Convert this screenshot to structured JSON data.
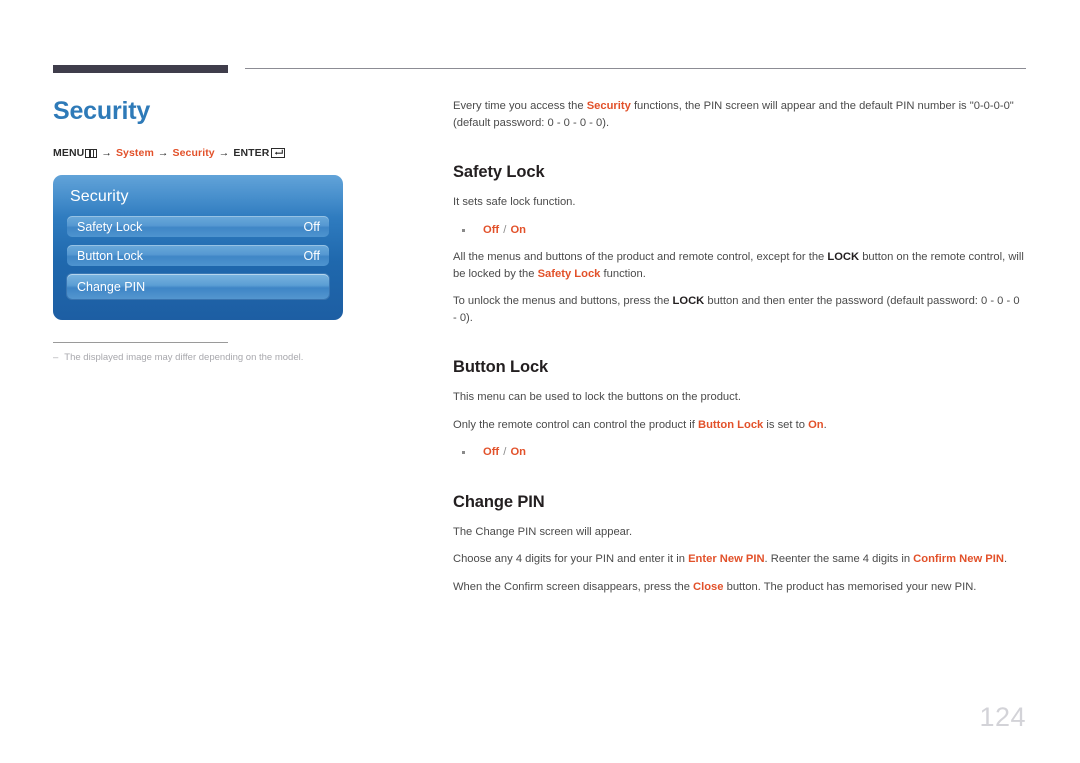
{
  "document": {
    "page_number": "124",
    "title": "Security"
  },
  "breadcrumb": {
    "menu_label": "MENU",
    "menu_icon": "menu-grid-icon",
    "arrow": "→",
    "step1": "System",
    "step2": "Security",
    "enter_label": "ENTER",
    "enter_icon": "enter-return-icon"
  },
  "osd": {
    "title": "Security",
    "rows": [
      {
        "label": "Safety Lock",
        "value": "Off",
        "highlight": false
      },
      {
        "label": "Button Lock",
        "value": "Off",
        "highlight": false
      },
      {
        "label": "Change PIN",
        "value": "",
        "highlight": true
      }
    ]
  },
  "footnote": {
    "dash": "–",
    "text": "The displayed image may differ depending on the model."
  },
  "intro": {
    "part1": "Every time you access the ",
    "highlight1": "Security",
    "part2": " functions, the PIN screen will appear and the default PIN number is \"0-0-0-0\" (default password: 0 - 0 - 0 - 0)."
  },
  "sections": [
    {
      "heading": "Safety Lock",
      "para1": "It sets safe lock function.",
      "bullet": {
        "off": "Off",
        "sep": " / ",
        "on": "On"
      },
      "para2_part1": "All the menus and buttons of the product and remote control, except for the ",
      "para2_bold1": "LOCK",
      "para2_part2": " button on the remote control, will be locked by the ",
      "para2_orange1": "Safety Lock",
      "para2_part3": " function.",
      "para3_part1": "To unlock the menus and buttons, press the ",
      "para3_bold1": "LOCK",
      "para3_part2": " button and then enter the password (default password: 0 - 0 - 0 - 0)."
    },
    {
      "heading": "Button Lock",
      "para1": "This menu can be used to lock the buttons on the product.",
      "para2_part1": "Only the remote control can control the product if ",
      "para2_orange1": "Button Lock",
      "para2_part2": " is set to ",
      "para2_orange2": "On",
      "para2_part3": ".",
      "bullet": {
        "off": "Off",
        "sep": " / ",
        "on": "On"
      }
    },
    {
      "heading": "Change PIN",
      "para1": "The Change PIN screen will appear.",
      "para2_part1": "Choose any 4 digits for your PIN and enter it in ",
      "para2_orange1": "Enter New PIN",
      "para2_part2": ". Reenter the same 4 digits in ",
      "para2_orange2": "Confirm New PIN",
      "para2_part3": ".",
      "para3_part1": "When the Confirm screen disappears, press the ",
      "para3_orange1": "Close",
      "para3_part2": " button. The product has memorised your new PIN."
    }
  ],
  "colors": {
    "accent_orange": "#e2512a",
    "title_blue": "#2e7ab8",
    "heading_dark": "#231f20",
    "panel_blue": "#1f68ad",
    "page_number_gray": "#d3d3d8"
  }
}
